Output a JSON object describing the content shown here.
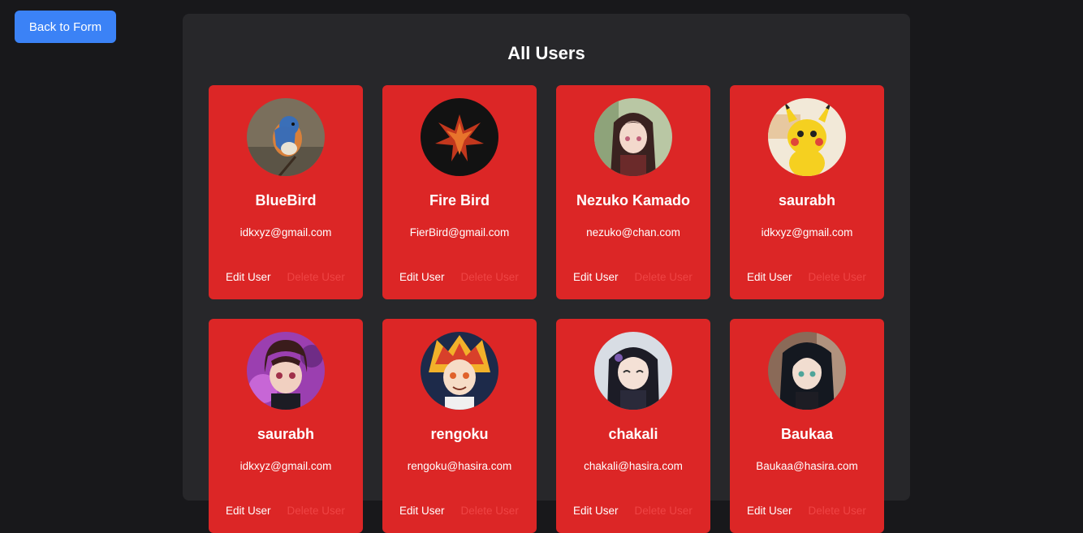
{
  "back_button": {
    "label": "Back to Form"
  },
  "title": "All Users",
  "actions": {
    "edit_label": "Edit User",
    "delete_label": "Delete User"
  },
  "colors": {
    "page_bg": "#18181b",
    "panel_bg": "#27272a",
    "card_bg": "#dc2626",
    "button_bg": "#3b82f6",
    "delete_text": "#ef4444"
  },
  "users": [
    {
      "name": "BlueBird",
      "email": "idkxyz@gmail.com",
      "avatar": "bluebird-photo"
    },
    {
      "name": "Fire Bird",
      "email": "FierBird@gmail.com",
      "avatar": "phoenix-art"
    },
    {
      "name": "Nezuko Kamado",
      "email": "nezuko@chan.com",
      "avatar": "anime-girl-portrait"
    },
    {
      "name": "saurabh",
      "email": "idkxyz@gmail.com",
      "avatar": "pikachu-image"
    },
    {
      "name": "saurabh",
      "email": "idkxyz@gmail.com",
      "avatar": "anime-boy-portrait"
    },
    {
      "name": "rengoku",
      "email": "rengoku@hasira.com",
      "avatar": "anime-flame-hair-portrait"
    },
    {
      "name": "chakali",
      "email": "chakali@hasira.com",
      "avatar": "anime-smiling-girl-portrait"
    },
    {
      "name": "Baukaa",
      "email": "Baukaa@hasira.com",
      "avatar": "anime-dark-hair-portrait"
    }
  ]
}
